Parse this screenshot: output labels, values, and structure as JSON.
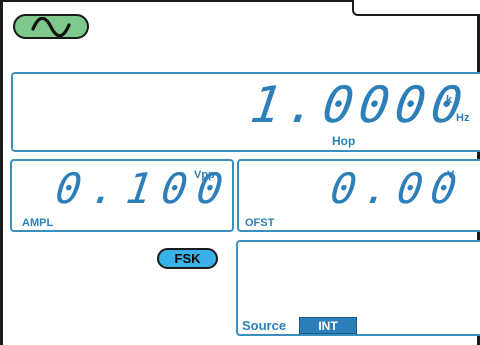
{
  "waveform": {
    "icon": "sine-wave-icon"
  },
  "frequency": {
    "value": "1.0000",
    "unit_prefix": "k",
    "unit": "Hz",
    "label": "Hop"
  },
  "amplitude": {
    "value": "0.100",
    "unit": "Vpp",
    "label": "AMPL"
  },
  "offset": {
    "value": "0.00",
    "unit": "V",
    "label": "OFST"
  },
  "fsk": {
    "label": "FSK"
  },
  "source": {
    "label": "Source",
    "value": "INT"
  },
  "colors": {
    "accent": "#2c7fb8",
    "panel_border": "#3a8fbf",
    "wave_button": "#7dc88a",
    "fsk_button": "#3ab0e8"
  }
}
